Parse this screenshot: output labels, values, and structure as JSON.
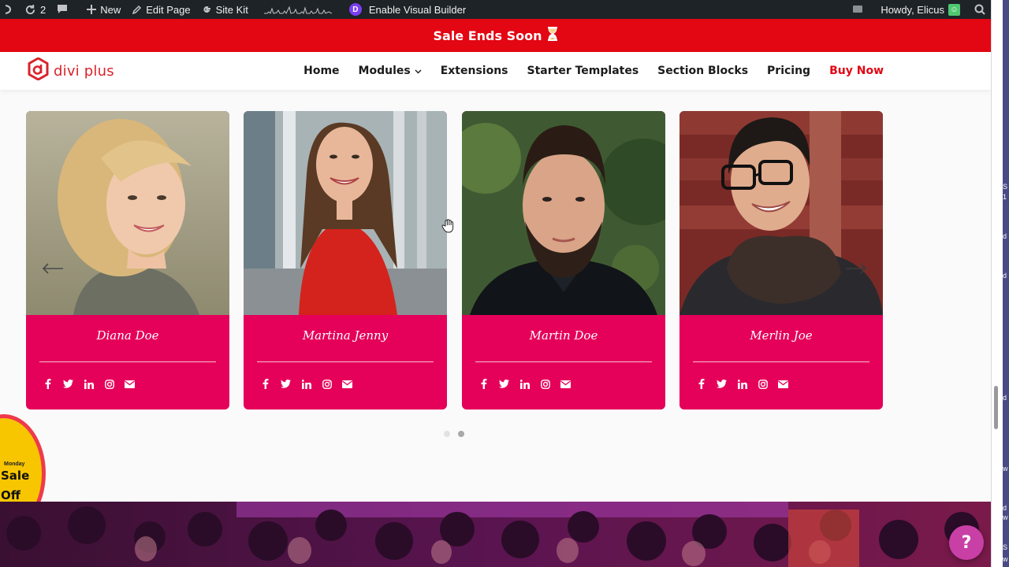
{
  "admin_bar": {
    "updates_count": "2",
    "new_label": "New",
    "edit_page_label": "Edit Page",
    "site_kit_label": "Site Kit",
    "visual_builder_badge": "D",
    "visual_builder_label": "Enable Visual Builder",
    "howdy_label": "Howdy, Elicus",
    "icons": [
      "wordpress-icon",
      "updates-icon",
      "comments-icon",
      "plus-icon",
      "pencil-icon",
      "google-g-icon",
      "sparkline-icon",
      "divi-icon",
      "screen-options-icon",
      "avatar-icon",
      "search-icon"
    ]
  },
  "sale_bar": {
    "text": "Sale Ends Soon",
    "icon": "hourglass-icon"
  },
  "header": {
    "logo_text": "divi plus",
    "nav": [
      {
        "label": "Home"
      },
      {
        "label": "Modules",
        "has_dropdown": true
      },
      {
        "label": "Extensions"
      },
      {
        "label": "Starter Templates"
      },
      {
        "label": "Section Blocks"
      },
      {
        "label": "Pricing"
      },
      {
        "label": "Buy Now",
        "highlight": true
      }
    ],
    "colors": {
      "brand_red": "#e30613",
      "logo_red": "#d8232a"
    }
  },
  "team": {
    "card_color": "#e5005a",
    "members": [
      {
        "name": "Diana Doe"
      },
      {
        "name": "Martina Jenny"
      },
      {
        "name": "Martin Doe"
      },
      {
        "name": "Merlin Joe"
      }
    ],
    "social_icons": [
      "facebook-icon",
      "twitter-icon",
      "linkedin-icon",
      "instagram-icon",
      "email-icon"
    ],
    "pagination": {
      "pages": 2,
      "active": 2
    }
  },
  "promo_badge": {
    "small": "Monday",
    "big": "Sale",
    "off": "Off"
  },
  "help_button": {
    "label": "?"
  },
  "side_strip_fragments": [
    "S",
    "1",
    "d",
    "d",
    "d",
    "w",
    "d",
    "w",
    "S",
    "w"
  ]
}
